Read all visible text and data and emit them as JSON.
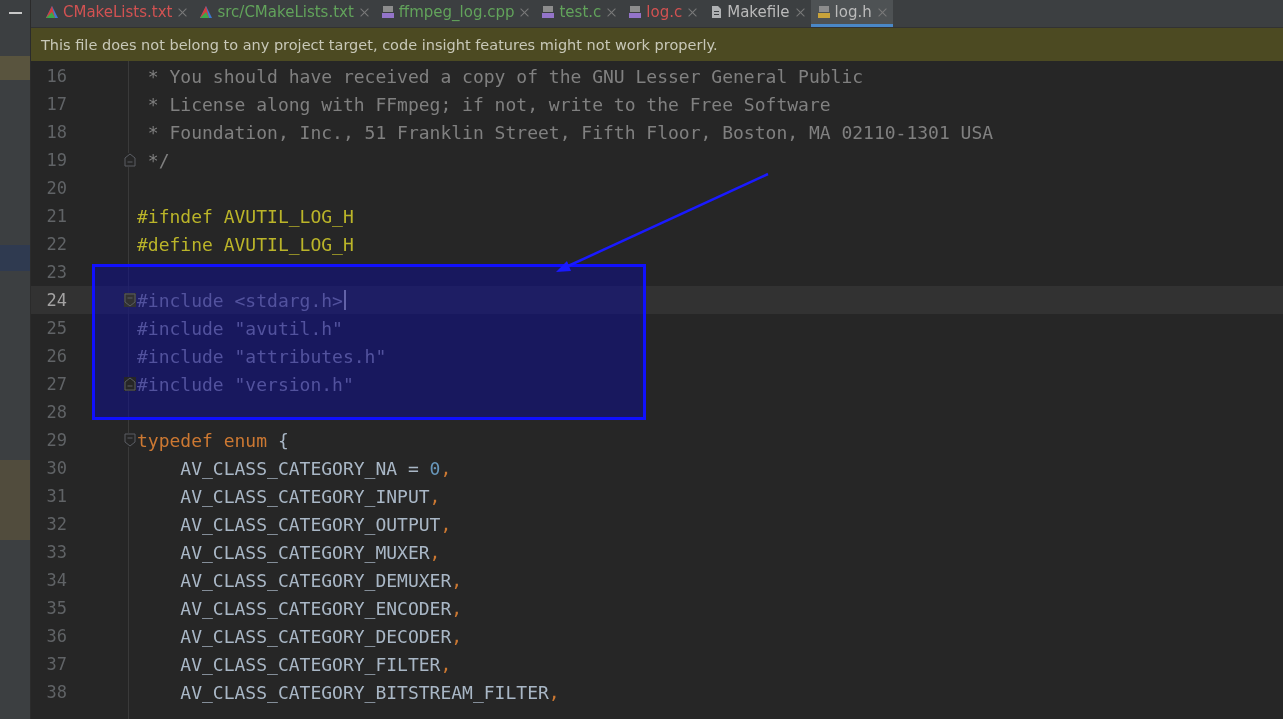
{
  "tabs": [
    {
      "label": "CMakeLists.txt",
      "kind": "cmake",
      "color": "#d25252",
      "selected": false
    },
    {
      "label": "src/CMakeLists.txt",
      "kind": "cmake",
      "color": "#62a35b",
      "selected": false
    },
    {
      "label": "ffmpeg_log.cpp",
      "kind": "cpp",
      "color": "#62a35b",
      "selected": false
    },
    {
      "label": "test.c",
      "kind": "c",
      "color": "#62a35b",
      "selected": false
    },
    {
      "label": "log.c",
      "kind": "c",
      "color": "#d25252",
      "selected": false
    },
    {
      "label": "Makefile",
      "kind": "makefile",
      "color": "#bbbbbb",
      "selected": false
    },
    {
      "label": "log.h",
      "kind": "h",
      "color": "#bbbbbb",
      "selected": true
    }
  ],
  "banner": {
    "text": "This file does not belong to any project target, code insight features might not work properly."
  },
  "editor": {
    "lines": [
      {
        "number": "16",
        "current": false,
        "tokens": [
          {
            "kind": "comment",
            "text": " * You should have received a copy of the GNU Lesser General Public"
          }
        ]
      },
      {
        "number": "17",
        "current": false,
        "tokens": [
          {
            "kind": "comment",
            "text": " * License along with FFmpeg; if not, write to the Free Software"
          }
        ]
      },
      {
        "number": "18",
        "current": false,
        "tokens": [
          {
            "kind": "comment",
            "text": " * Foundation, Inc., 51 Franklin Street, Fifth Floor, Boston, MA 02110-1301 USA"
          }
        ]
      },
      {
        "number": "19",
        "current": false,
        "kind": "fold_end",
        "tokens": [
          {
            "kind": "comment",
            "text": " */"
          }
        ]
      },
      {
        "number": "20",
        "current": false
      },
      {
        "number": "21",
        "current": false,
        "tokens": [
          {
            "kind": "directive",
            "text": "#ifndef AVUTIL_LOG_H"
          }
        ]
      },
      {
        "number": "22",
        "current": false,
        "tokens": [
          {
            "kind": "directive",
            "text": "#define AVUTIL_LOG_H"
          }
        ]
      },
      {
        "number": "23",
        "current": false
      },
      {
        "number": "24",
        "current": true,
        "kind": "fold_start",
        "tokens": [
          {
            "kind": "include",
            "text": "#include <stdarg.h>"
          }
        ]
      },
      {
        "number": "25",
        "current": false,
        "tokens": [
          {
            "kind": "include",
            "text": "#include \"avutil.h\""
          }
        ]
      },
      {
        "number": "26",
        "current": false,
        "tokens": [
          {
            "kind": "include",
            "text": "#include \"attributes.h\""
          }
        ]
      },
      {
        "number": "27",
        "current": false,
        "kind": "fold_end",
        "tokens": [
          {
            "kind": "include",
            "text": "#include \"version.h\""
          }
        ]
      },
      {
        "number": "28",
        "current": false
      },
      {
        "number": "29",
        "current": false,
        "kind": "fold_start",
        "tokens": [
          {
            "kind": "keyword",
            "text": "typedef enum "
          },
          {
            "kind": "plain",
            "text": "{"
          }
        ]
      },
      {
        "number": "30",
        "current": false,
        "tokens": [
          {
            "kind": "plain",
            "text": "    AV_CLASS_CATEGORY_NA = "
          },
          {
            "kind": "number",
            "text": "0"
          },
          {
            "kind": "punct",
            "text": ","
          }
        ]
      },
      {
        "number": "31",
        "current": false,
        "tokens": [
          {
            "kind": "plain",
            "text": "    AV_CLASS_CATEGORY_INPUT"
          },
          {
            "kind": "punct",
            "text": ","
          }
        ]
      },
      {
        "number": "32",
        "current": false,
        "tokens": [
          {
            "kind": "plain",
            "text": "    AV_CLASS_CATEGORY_OUTPUT"
          },
          {
            "kind": "punct",
            "text": ","
          }
        ]
      },
      {
        "number": "33",
        "current": false,
        "tokens": [
          {
            "kind": "plain",
            "text": "    AV_CLASS_CATEGORY_MUXER"
          },
          {
            "kind": "punct",
            "text": ","
          }
        ]
      },
      {
        "number": "34",
        "current": false,
        "tokens": [
          {
            "kind": "plain",
            "text": "    AV_CLASS_CATEGORY_DEMUXER"
          },
          {
            "kind": "punct",
            "text": ","
          }
        ]
      },
      {
        "number": "35",
        "current": false,
        "tokens": [
          {
            "kind": "plain",
            "text": "    AV_CLASS_CATEGORY_ENCODER"
          },
          {
            "kind": "punct",
            "text": ","
          }
        ]
      },
      {
        "number": "36",
        "current": false,
        "tokens": [
          {
            "kind": "plain",
            "text": "    AV_CLASS_CATEGORY_DECODER"
          },
          {
            "kind": "punct",
            "text": ","
          }
        ]
      },
      {
        "number": "37",
        "current": false,
        "tokens": [
          {
            "kind": "plain",
            "text": "    AV_CLASS_CATEGORY_FILTER"
          },
          {
            "kind": "punct",
            "text": ","
          }
        ]
      },
      {
        "number": "38",
        "current": false,
        "tokens": [
          {
            "kind": "plain",
            "text": "    AV_CLASS_CATEGORY_BITSTREAM_FILTER"
          },
          {
            "kind": "punct",
            "text": ","
          }
        ]
      }
    ]
  }
}
